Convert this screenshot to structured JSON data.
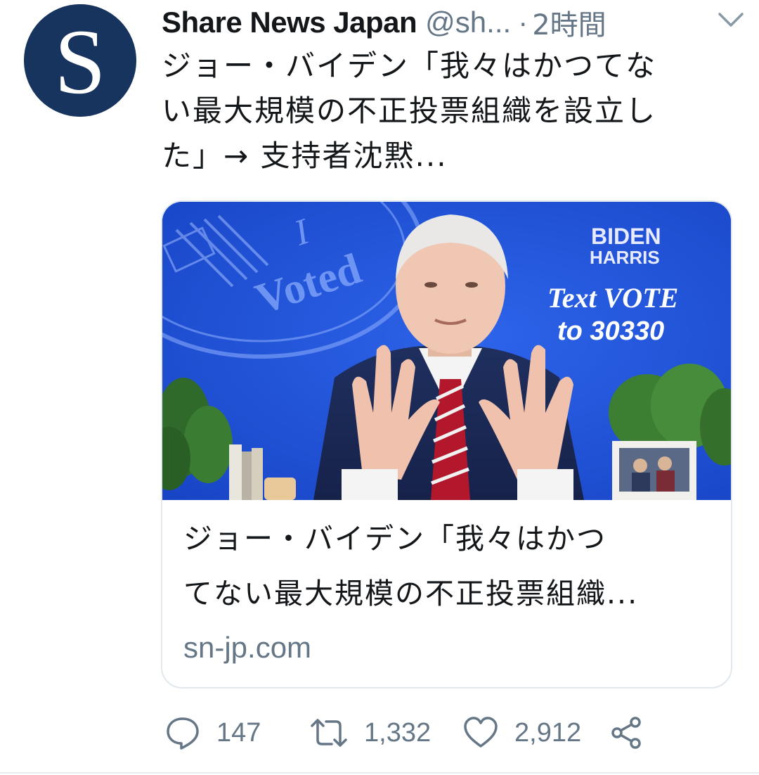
{
  "tweet": {
    "avatar_letter": "S",
    "display_name": "Share News Japan",
    "handle": "@sh...",
    "separator": "·",
    "time": "2時間",
    "text_lines": [
      "ジョー・バイデン「我々はかつてな",
      "い最大規模の不正投票組織を設立し",
      "た」→ 支持者沈黙..."
    ]
  },
  "card": {
    "image_text": {
      "voted_top": "I",
      "voted_bottom": "Voted",
      "brand_top": "BIDEN",
      "brand_bottom": "HARRIS",
      "cta_line1": "Text VOTE",
      "cta_line2": "to 30330"
    },
    "title_lines": [
      "ジョー・バイデン「我々はかつ",
      "てない最大規模の不正投票組織..."
    ],
    "domain": "sn-jp.com"
  },
  "actions": {
    "replies": "147",
    "retweets": "1,332",
    "likes": "2,912"
  },
  "colors": {
    "text_primary": "#14171a",
    "text_secondary": "#657786",
    "avatar_bg": "#17345f",
    "card_border": "#e1e8ed",
    "image_bg": "#1d50d8"
  },
  "icons": {
    "menu": "chevron-down-icon",
    "reply": "speech-bubble-icon",
    "retweet": "retweet-arrows-icon",
    "like": "heart-icon",
    "share": "share-nodes-icon"
  }
}
